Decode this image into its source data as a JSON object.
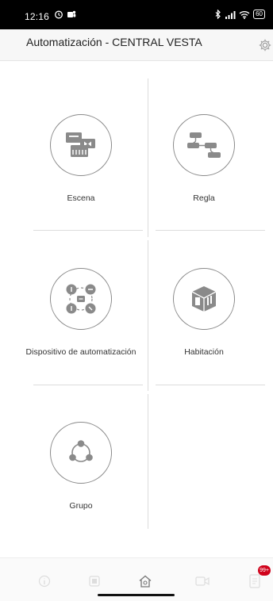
{
  "status_bar": {
    "time": "12:16",
    "battery": "60",
    "left_icons": [
      "alarm-icon",
      "teams-icon"
    ],
    "right_icons": [
      "bluetooth-icon",
      "cell-signal-icon",
      "wifi-icon",
      "battery-icon"
    ]
  },
  "header": {
    "title": "Automatización - CENTRAL VESTA",
    "settings_icon": "gear-icon"
  },
  "tiles": [
    {
      "label": "Escena",
      "icon": "scene-icon"
    },
    {
      "label": "Regla",
      "icon": "rule-flow-icon"
    },
    {
      "label": "Dispositivo de automatización",
      "icon": "automation-device-icon"
    },
    {
      "label": "Habitación",
      "icon": "room-cube-icon"
    },
    {
      "label": "Grupo",
      "icon": "group-icon"
    }
  ],
  "bottom_nav": {
    "items": [
      {
        "icon": "info-icon"
      },
      {
        "icon": "device-icon"
      },
      {
        "icon": "home-icon",
        "active": true
      },
      {
        "icon": "camera-icon"
      },
      {
        "icon": "notifications-icon",
        "badge": "99+"
      }
    ]
  },
  "colors": {
    "accent_badge": "#d0021b",
    "divider": "#dcdcdc",
    "icon_gray": "#8a8a8a"
  }
}
